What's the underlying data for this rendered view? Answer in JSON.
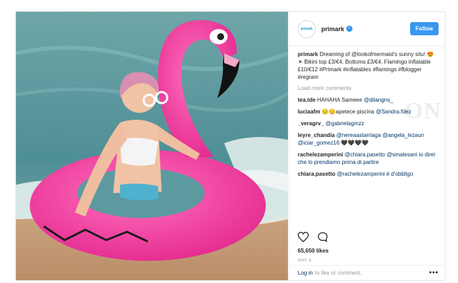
{
  "header": {
    "avatar_text": "primark",
    "username": "primark",
    "verified_icon": "verified-check-icon",
    "follow_label": "Follow"
  },
  "caption": {
    "user": "primark",
    "text": "Dreaming of @lookofmermaid's sunny situ! 😍☀ Bikini top £3/€4. Bottoms £3/€4. Flamingo inflatable £10/€12 #Primark #inflatables #flamingo #fblogger #regram"
  },
  "load_more": "Load more comments",
  "comments": [
    {
      "user": "tea.tde",
      "text": "HAHAHA Sameee",
      "mention": "@dilangns_"
    },
    {
      "user": "luciaafm",
      "text": "😔😔apetece piscina",
      "mention": "@Sandra.fdez"
    },
    {
      "user": "_veragrv_",
      "text": "",
      "mention": "@gabrielagmzz"
    },
    {
      "user": "leyre_chandia",
      "text": "",
      "mention": "@nereaastarriaga @angela_lezaun @iciar_gomez16 🖤🖤🖤🖤"
    },
    {
      "user": "rachelezamperini",
      "text": "",
      "mention": "@chiara.pasetto @smalesani io direi che lo prendiamo prima di partire"
    },
    {
      "user": "chiara.pasetto",
      "text": "",
      "mention": "@rachelezamperini è d'obbligo"
    }
  ],
  "watermark": "ON",
  "likes": "65,650 likes",
  "date": "MAY 6",
  "footer": {
    "login_label": "Log in",
    "rest": "to like or comment.",
    "more_icon": "more-options-icon"
  },
  "colors": {
    "accent": "#3897f0",
    "link": "#003569",
    "muted": "#999999",
    "flamingo": "#ee3f9d"
  }
}
